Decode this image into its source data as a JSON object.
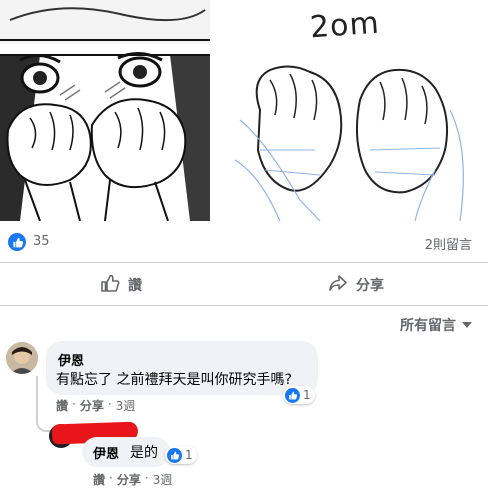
{
  "post": {
    "image_caption": "2om",
    "reaction_count": "35",
    "comment_count": "2則留言"
  },
  "actions": {
    "like_label": "讚",
    "share_label": "分享"
  },
  "filter_label": "所有留言",
  "comments": [
    {
      "author": "伊恩",
      "text": "有點忘了 之前禮拜天是叫你研究手嗎?",
      "like_count": "1",
      "like_action": "讚",
      "reply_action": "分享",
      "time": "3週"
    }
  ],
  "reply": {
    "author": "伊恩",
    "text": "是的",
    "like_count": "1",
    "like_action": "讚",
    "reply_action": "分享",
    "time": "3週"
  },
  "colors": {
    "accent": "#1877f2",
    "secondary_text": "#65676b",
    "bubble": "#f0f2f5",
    "redaction": "#e8161b"
  },
  "icons": [
    "like-badge-icon",
    "thumbs-up-icon",
    "share-arrow-icon",
    "caret-down-icon"
  ]
}
